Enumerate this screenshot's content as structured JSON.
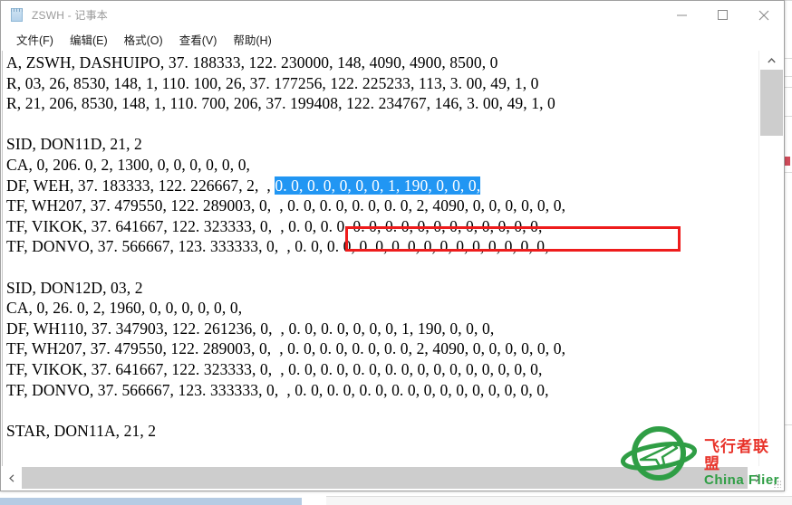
{
  "window": {
    "title": "ZSWH - 记事本",
    "icon": "notepad-icon",
    "controls": {
      "minimize": "—",
      "maximize": "□",
      "close": "✕"
    }
  },
  "menu": {
    "items": [
      {
        "label": "文件(F)"
      },
      {
        "label": "编辑(E)"
      },
      {
        "label": "格式(O)"
      },
      {
        "label": "查看(V)"
      },
      {
        "label": "帮助(H)"
      }
    ]
  },
  "editor": {
    "lines": [
      {
        "text": "A, ZSWH, DASHUIPO, 37. 188333, 122. 230000, 148, 4090, 4900, 8500, 0"
      },
      {
        "text": "R, 03, 26, 8530, 148, 1, 110. 100, 26, 37. 177256, 122. 225233, 113, 3. 00, 49, 1, 0"
      },
      {
        "text": "R, 21, 206, 8530, 148, 1, 110. 700, 206, 37. 199408, 122. 234767, 146, 3. 00, 49, 1, 0"
      },
      {
        "text": ""
      },
      {
        "text": "SID, DON11D, 21, 2"
      },
      {
        "text": "CA, 0, 206. 0, 2, 1300, 0, 0, 0, 0, 0, 0,"
      },
      {
        "text": "DF, WEH, 37. 183333, 122. 226667, 2,  , ",
        "selected": "0. 0, 0. 0, 0, 0, 0, 1, 190, 0, 0, 0,"
      },
      {
        "text": "TF, WH207, 37. 479550, 122. 289003, 0,  , 0. 0, 0. 0, 0. 0, 0. 0, 2, 4090, 0, 0, 0, 0, 0, 0,"
      },
      {
        "text": "TF, VIKOK, 37. 641667, 122. 323333, 0,  , 0. 0, 0. 0, 0. 0, 0. 0, 0, 0, 0, 0, 0, 0, 0, 0,"
      },
      {
        "text": "TF, DONVO, 37. 566667, 123. 333333, 0,  , 0. 0, 0. 0, 0. 0, 0. 0, 0, 0, 0, 0, 0, 0, 0, 0,"
      },
      {
        "text": ""
      },
      {
        "text": "SID, DON12D, 03, 2"
      },
      {
        "text": "CA, 0, 26. 0, 2, 1960, 0, 0, 0, 0, 0, 0,"
      },
      {
        "text": "DF, WH110, 37. 347903, 122. 261236, 0,  , 0. 0, 0. 0, 0, 0, 0, 1, 190, 0, 0, 0,"
      },
      {
        "text": "TF, WH207, 37. 479550, 122. 289003, 0,  , 0. 0, 0. 0, 0. 0, 0. 0, 2, 4090, 0, 0, 0, 0, 0, 0,"
      },
      {
        "text": "TF, VIKOK, 37. 641667, 122. 323333, 0,  , 0. 0, 0. 0, 0. 0, 0. 0, 0, 0, 0, 0, 0, 0, 0, 0,"
      },
      {
        "text": "TF, DONVO, 37. 566667, 123. 333333, 0,  , 0. 0, 0. 0, 0. 0, 0. 0, 0, 0, 0, 0, 0, 0, 0, 0,"
      },
      {
        "text": ""
      },
      {
        "text": "STAR, DON11A, 21, 2"
      }
    ]
  },
  "watermark": {
    "cn": "飞行者联盟",
    "en": "China Flier",
    "logo_color": "#2f9e45",
    "cn_color": "#e8332a"
  },
  "annotation": {
    "box_color": "#ee1c1c",
    "selection_color": "#2196f3"
  }
}
